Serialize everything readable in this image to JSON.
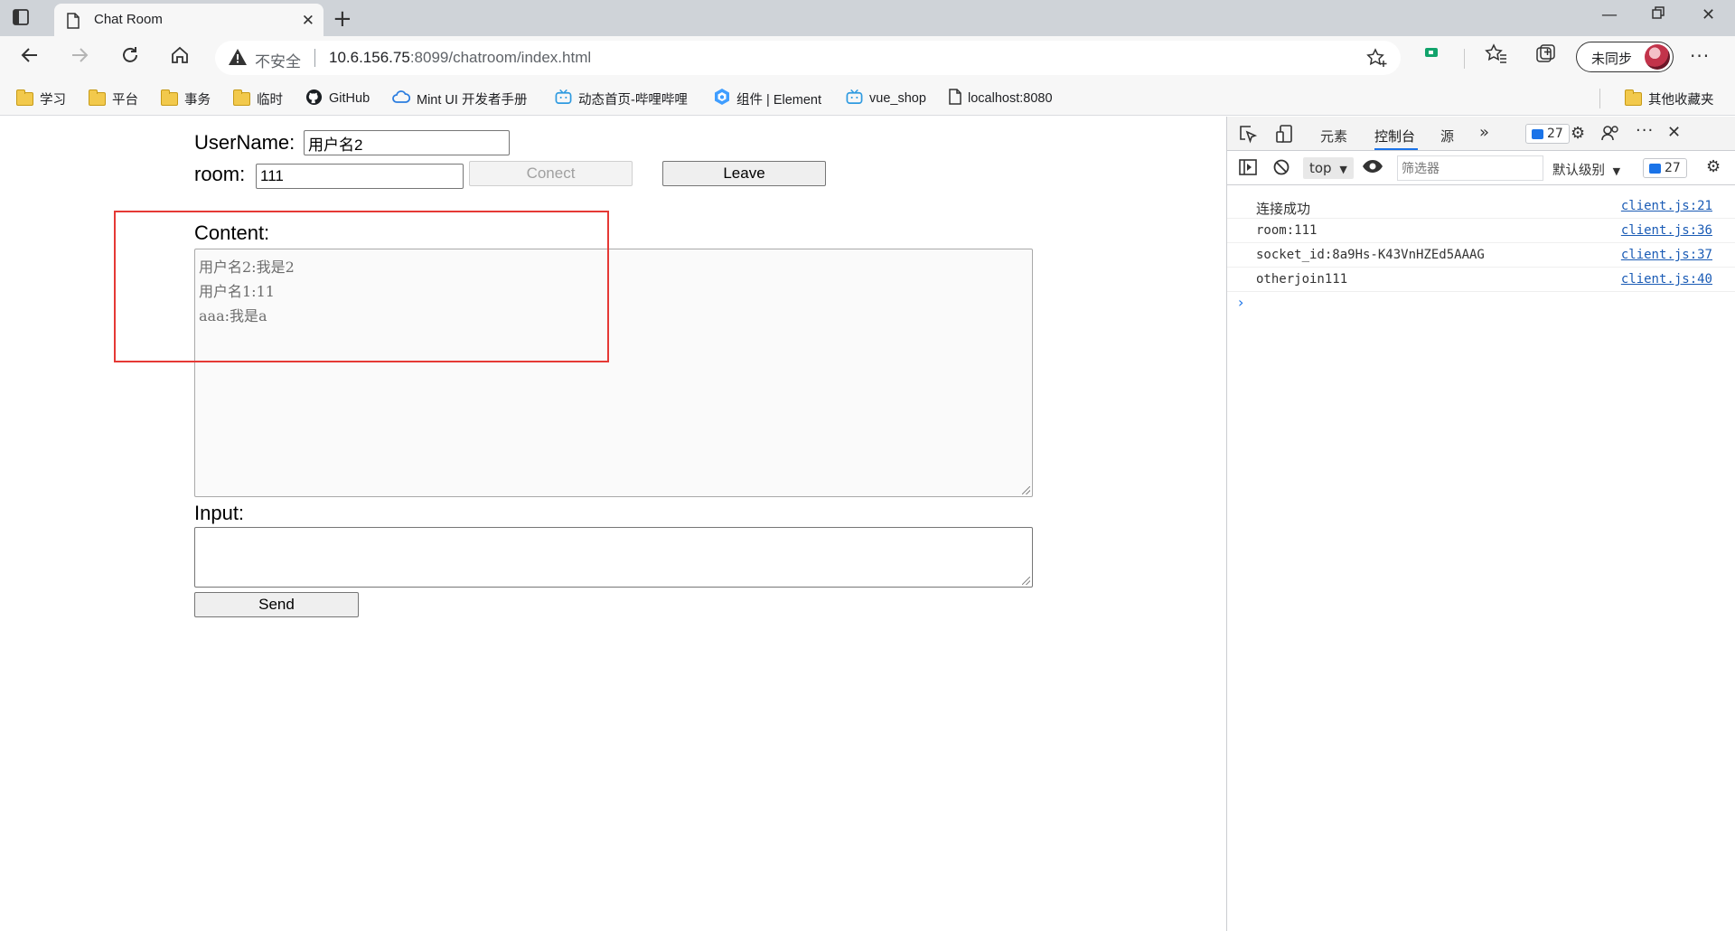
{
  "browser": {
    "tab_title": "Chat Room",
    "address": {
      "security_label": "不安全",
      "host": "10.6.156.75",
      "path": ":8099/chatroom/index.html"
    },
    "sync_label": "未同步",
    "bookmarks": [
      {
        "label": "学习",
        "icon": "folder-icon"
      },
      {
        "label": "平台",
        "icon": "folder-icon"
      },
      {
        "label": "事务",
        "icon": "folder-icon"
      },
      {
        "label": "临时",
        "icon": "folder-icon"
      },
      {
        "label": "GitHub",
        "icon": "github-icon"
      },
      {
        "label": "Mint UI 开发者手册",
        "icon": "cloud-icon"
      },
      {
        "label": "动态首页-哔哩哔哩",
        "icon": "bilibili-icon"
      },
      {
        "label": "组件 | Element",
        "icon": "element-icon"
      },
      {
        "label": "vue_shop",
        "icon": "bilibili-icon"
      },
      {
        "label": "localhost:8080",
        "icon": "page-icon"
      }
    ],
    "other_bookmarks": "其他收藏夹"
  },
  "page": {
    "username_label": "UserName:",
    "username_value": "用户名2",
    "room_label": "room:",
    "room_value": "111",
    "connect_button": "Conect",
    "leave_button": "Leave",
    "content_label": "Content:",
    "messages": [
      "用户名2:我是2",
      "用户名1:11",
      "aaa:我是a"
    ],
    "input_label": "Input:",
    "input_value": "",
    "send_button": "Send",
    "highlight_color": "#e53935"
  },
  "devtools": {
    "tabs": [
      "元素",
      "控制台",
      "源"
    ],
    "active_tab": "控制台",
    "issue_count": "27",
    "context": "top",
    "filter_placeholder": "筛选器",
    "levels_label": "默认级别",
    "message_count": "27",
    "console": [
      {
        "text": "连接成功",
        "source": "client.js:21"
      },
      {
        "text": "room:111",
        "source": "client.js:36"
      },
      {
        "text": "socket_id:8a9Hs-K43VnHZEd5AAAG",
        "source": "client.js:37"
      },
      {
        "text": "otherjoin111",
        "source": "client.js:40"
      }
    ]
  }
}
